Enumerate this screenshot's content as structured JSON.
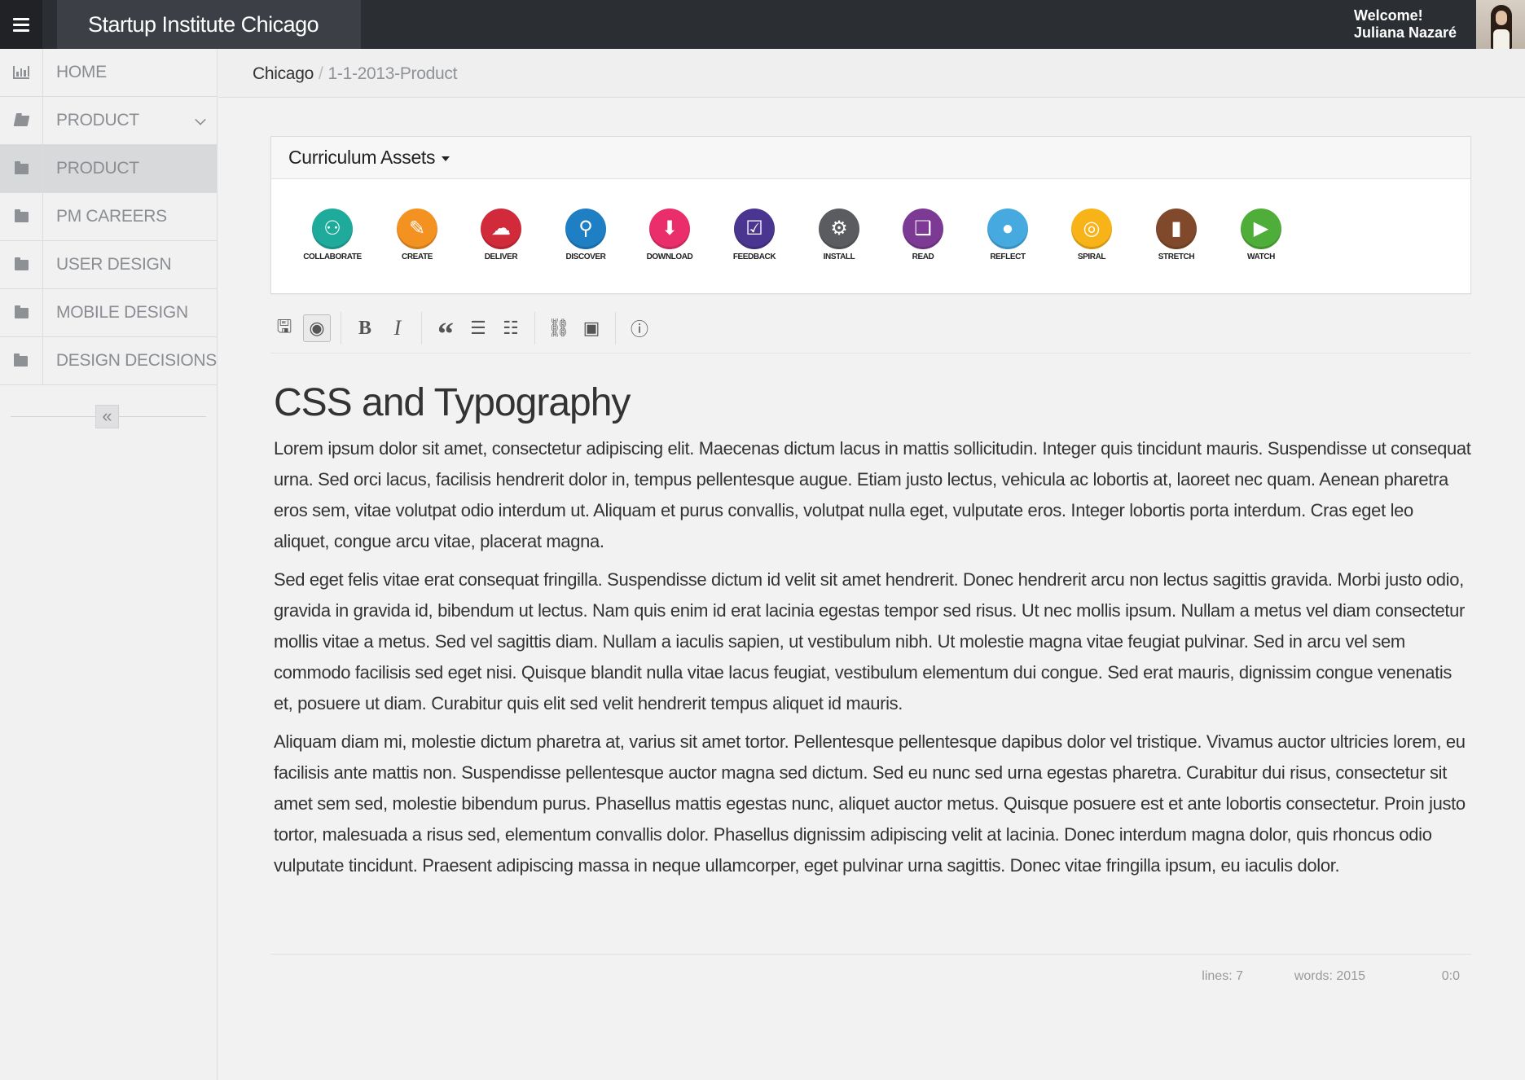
{
  "app": {
    "title": "Startup Institute Chicago",
    "welcome_line1": "Welcome!",
    "welcome_line2": "Juliana Nazaré"
  },
  "sidebar": {
    "items": [
      {
        "label": "HOME",
        "icon": "bar-chart-icon"
      },
      {
        "label": "PRODUCT",
        "icon": "folder-open-icon",
        "expandable": true
      },
      {
        "label": "PRODUCT",
        "icon": "folder-icon",
        "active": true
      },
      {
        "label": "PM CAREERS",
        "icon": "folder-icon"
      },
      {
        "label": "USER DESIGN",
        "icon": "folder-icon"
      },
      {
        "label": "MOBILE DESIGN",
        "icon": "folder-icon"
      },
      {
        "label": "DESIGN DECISIONS",
        "icon": "folder-icon"
      }
    ],
    "collapse_label": "«"
  },
  "breadcrumb": {
    "root": "Chicago",
    "separator": "/",
    "current": "1-1-2013-Product"
  },
  "assets": {
    "title": "Curriculum Assets",
    "items": [
      {
        "label": "COLLABORATE",
        "color": "#1fab9b",
        "icon": "people-icon",
        "glyph": "⚇"
      },
      {
        "label": "CREATE",
        "color": "#f39221",
        "icon": "pencil-icon",
        "glyph": "✎"
      },
      {
        "label": "DELIVER",
        "color": "#d02a3b",
        "icon": "cloud-upload-icon",
        "glyph": "☁"
      },
      {
        "label": "DISCOVER",
        "color": "#1f7fc4",
        "icon": "lightbulb-icon",
        "glyph": "⚲"
      },
      {
        "label": "DOWNLOAD",
        "color": "#ea2e6b",
        "icon": "download-icon",
        "glyph": "⬇"
      },
      {
        "label": "FEEDBACK",
        "color": "#4a3690",
        "icon": "checkbox-icon",
        "glyph": "☑"
      },
      {
        "label": "INSTALL",
        "color": "#5a5c60",
        "icon": "gears-icon",
        "glyph": "⚙"
      },
      {
        "label": "READ",
        "color": "#7d3a94",
        "icon": "book-icon",
        "glyph": "❑"
      },
      {
        "label": "REFLECT",
        "color": "#46a9df",
        "icon": "thought-bubble-icon",
        "glyph": "●"
      },
      {
        "label": "SPIRAL",
        "color": "#f7b318",
        "icon": "spiral-icon",
        "glyph": "◎"
      },
      {
        "label": "STRETCH",
        "color": "#80492b",
        "icon": "bar-chart-icon",
        "glyph": "▮"
      },
      {
        "label": "WATCH",
        "color": "#4fae39",
        "icon": "play-icon",
        "glyph": "▶"
      }
    ]
  },
  "toolbar": {
    "buttons": [
      {
        "name": "save-icon",
        "glyph": "🖫"
      },
      {
        "name": "preview-eye-icon",
        "glyph": "◉"
      },
      {
        "name": "bold-icon",
        "glyph": "B"
      },
      {
        "name": "italic-icon",
        "glyph": "I"
      },
      {
        "name": "quote-icon",
        "glyph": "“"
      },
      {
        "name": "bullet-list-icon",
        "glyph": "☰"
      },
      {
        "name": "numbered-list-icon",
        "glyph": "☷"
      },
      {
        "name": "link-icon",
        "glyph": "⛓"
      },
      {
        "name": "image-icon",
        "glyph": "▣"
      },
      {
        "name": "info-icon",
        "glyph": "ⓘ"
      }
    ]
  },
  "document": {
    "title": "CSS and Typography",
    "paragraphs": [
      "Lorem ipsum dolor sit amet, consectetur adipiscing elit. Maecenas dictum lacus in mattis sollicitudin. Integer quis tincidunt mauris. Suspendisse ut consequat urna. Sed orci lacus, facilisis hendrerit dolor in, tempus pellentesque augue. Etiam justo lectus, vehicula ac lobortis at, laoreet nec quam. Aenean pharetra eros sem, vitae volutpat odio interdum ut. Aliquam et purus convallis, volutpat nulla eget, vulputate eros. Integer lobortis porta interdum. Cras eget leo aliquet, congue arcu vitae, placerat magna.",
      "Sed eget felis vitae erat consequat fringilla. Suspendisse dictum id velit sit amet hendrerit. Donec hendrerit arcu non lectus sagittis gravida. Morbi justo odio, gravida in gravida id, bibendum ut lectus. Nam quis enim id erat lacinia egestas tempor sed risus. Ut nec mollis ipsum. Nullam a metus vel diam consectetur mollis vitae a metus. Sed vel sagittis diam. Nullam a iaculis sapien, ut vestibulum nibh. Ut molestie magna vitae feugiat pulvinar. Sed in arcu vel sem commodo facilisis sed eget nisi. Quisque blandit nulla vitae lacus feugiat, vestibulum elementum dui congue. Sed erat mauris, dignissim congue venenatis et, posuere ut diam. Curabitur quis elit sed velit hendrerit tempus aliquet id mauris.",
      "Aliquam diam mi, molestie dictum pharetra at, varius sit amet tortor. Pellentesque pellentesque dapibus dolor vel tristique. Vivamus auctor ultricies lorem, eu facilisis ante mattis non. Suspendisse pellentesque auctor magna sed dictum. Sed eu nunc sed urna egestas pharetra. Curabitur dui risus, consectetur sit amet sem sed, molestie bibendum purus. Phasellus mattis egestas nunc, aliquet auctor metus. Quisque posuere est et ante lobortis consectetur. Proin justo tortor, malesuada a risus sed, elementum convallis dolor. Phasellus dignissim adipiscing velit at lacinia. Donec interdum magna dolor, quis rhoncus odio vulputate tincidunt. Praesent adipiscing massa in neque ullamcorper, eget pulvinar urna sagittis. Donec vitae fringilla ipsum, eu iaculis dolor."
    ]
  },
  "status": {
    "lines": "lines: 7",
    "words": "words: 2015",
    "cursor": "0:0"
  }
}
